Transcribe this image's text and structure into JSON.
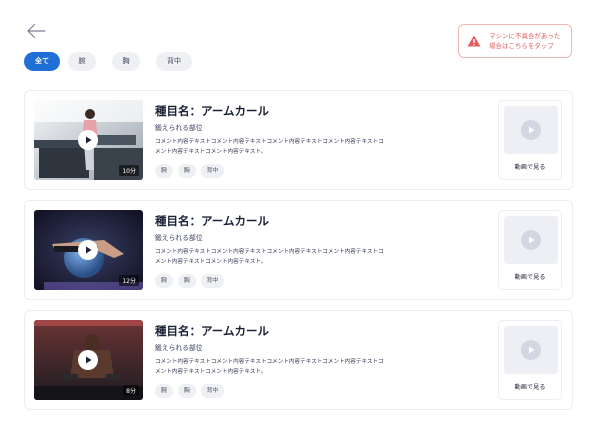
{
  "alert": {
    "line1": "マシンに不具合があった",
    "line2": "場合はこちらをタップ",
    "icon": "warning-icon",
    "color": "#e25c5c"
  },
  "filters": {
    "items": [
      {
        "label": "全て",
        "active": true
      },
      {
        "label": "腕",
        "active": false
      },
      {
        "label": "胸",
        "active": false
      },
      {
        "label": "背中",
        "active": false
      }
    ],
    "accent": "#1f6fd6"
  },
  "exercises": [
    {
      "title": "種目名：アームカール",
      "subtitle": "鍛えられる部位",
      "comment": "コメント内容テキストコメント内容テキストコメント内容テキストコメント内容テキストコメント内容テキストコメント内容テキスト。",
      "tags": [
        "腕",
        "胸",
        "背中"
      ],
      "duration": "10分",
      "video_label": "動画で見る"
    },
    {
      "title": "種目名：アームカール",
      "subtitle": "鍛えられる部位",
      "comment": "コメント内容テキストコメント内容テキストコメント内容テキストコメント内容テキストコメント内容テキストコメント内容テキスト。",
      "tags": [
        "腕",
        "胸",
        "背中"
      ],
      "duration": "12分",
      "video_label": "動画で見る"
    },
    {
      "title": "種目名：アームカール",
      "subtitle": "鍛えられる部位",
      "comment": "コメント内容テキストコメント内容テキストコメント内容テキストコメント内容テキストコメント内容テキストコメント内容テキスト。",
      "tags": [
        "腕",
        "胸",
        "背中"
      ],
      "duration": "8分",
      "video_label": "動画で見る"
    }
  ]
}
